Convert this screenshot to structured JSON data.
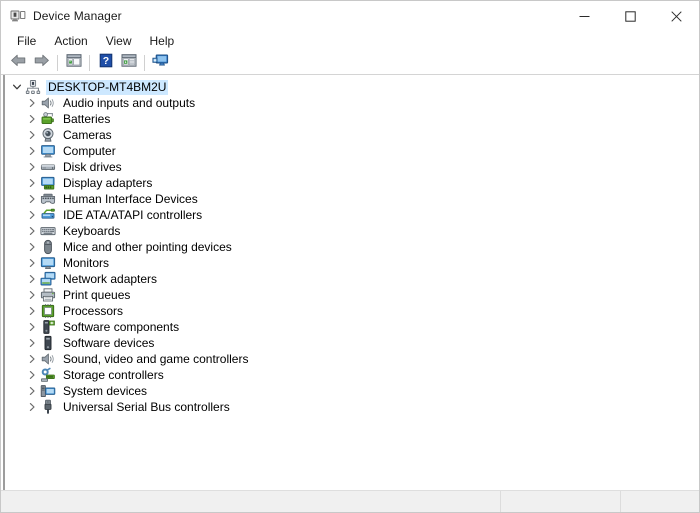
{
  "window": {
    "title": "Device Manager",
    "icon": "device-manager-icon",
    "controls": {
      "minimize": "minimize-icon",
      "maximize": "maximize-icon",
      "close": "close-icon"
    }
  },
  "menubar": {
    "items": [
      {
        "label": "File",
        "name": "menu-file"
      },
      {
        "label": "Action",
        "name": "menu-action"
      },
      {
        "label": "View",
        "name": "menu-view"
      },
      {
        "label": "Help",
        "name": "menu-help"
      }
    ]
  },
  "toolbar": {
    "buttons": [
      {
        "name": "back-button",
        "icon": "back-arrow-icon",
        "tooltip": "Back"
      },
      {
        "name": "forward-button",
        "icon": "forward-arrow-icon",
        "tooltip": "Forward"
      },
      {
        "name": "show-hide-console-tree-button",
        "icon": "console-tree-icon",
        "tooltip": "Show/Hide Console Tree"
      },
      {
        "name": "help-button",
        "icon": "help-question-icon",
        "tooltip": "Help"
      },
      {
        "name": "properties-button",
        "icon": "properties-window-icon",
        "tooltip": "Properties"
      },
      {
        "name": "scan-hardware-changes-button",
        "icon": "monitor-scan-icon",
        "tooltip": "Scan for hardware changes"
      }
    ]
  },
  "tree": {
    "root": {
      "label": "DESKTOP-MT4BM2U",
      "icon": "computer-root-icon",
      "expanded": true,
      "selected": true
    },
    "children": [
      {
        "label": "Audio inputs and outputs",
        "icon": "speaker-icon",
        "expanded": false
      },
      {
        "label": "Batteries",
        "icon": "battery-icon",
        "expanded": false
      },
      {
        "label": "Cameras",
        "icon": "camera-icon",
        "expanded": false
      },
      {
        "label": "Computer",
        "icon": "computer-icon",
        "expanded": false
      },
      {
        "label": "Disk drives",
        "icon": "disk-drive-icon",
        "expanded": false
      },
      {
        "label": "Display adapters",
        "icon": "display-adapter-icon",
        "expanded": false
      },
      {
        "label": "Human Interface Devices",
        "icon": "hid-icon",
        "expanded": false
      },
      {
        "label": "IDE ATA/ATAPI controllers",
        "icon": "ide-controller-icon",
        "expanded": false
      },
      {
        "label": "Keyboards",
        "icon": "keyboard-icon",
        "expanded": false
      },
      {
        "label": "Mice and other pointing devices",
        "icon": "mouse-icon",
        "expanded": false
      },
      {
        "label": "Monitors",
        "icon": "monitor-icon",
        "expanded": false
      },
      {
        "label": "Network adapters",
        "icon": "network-adapter-icon",
        "expanded": false
      },
      {
        "label": "Print queues",
        "icon": "printer-icon",
        "expanded": false
      },
      {
        "label": "Processors",
        "icon": "processor-icon",
        "expanded": false
      },
      {
        "label": "Software components",
        "icon": "software-component-icon",
        "expanded": false
      },
      {
        "label": "Software devices",
        "icon": "software-device-icon",
        "expanded": false
      },
      {
        "label": "Sound, video and game controllers",
        "icon": "sound-video-game-icon",
        "expanded": false
      },
      {
        "label": "Storage controllers",
        "icon": "storage-controller-icon",
        "expanded": false
      },
      {
        "label": "System devices",
        "icon": "system-device-icon",
        "expanded": false
      },
      {
        "label": "Universal Serial Bus controllers",
        "icon": "usb-controller-icon",
        "expanded": false
      }
    ]
  },
  "statusbar": {
    "panes": [
      {
        "text": "",
        "name": "status-pane-main"
      },
      {
        "text": "",
        "name": "status-pane-secondary"
      },
      {
        "text": "",
        "name": "status-pane-tertiary"
      }
    ]
  },
  "colors": {
    "selection": "#cde8ff",
    "window_bg": "#ffffff",
    "statusbar_bg": "#f0f0f0",
    "text": "#000000",
    "accent_blue": "#2f5d9e",
    "green": "#5aa22a"
  }
}
